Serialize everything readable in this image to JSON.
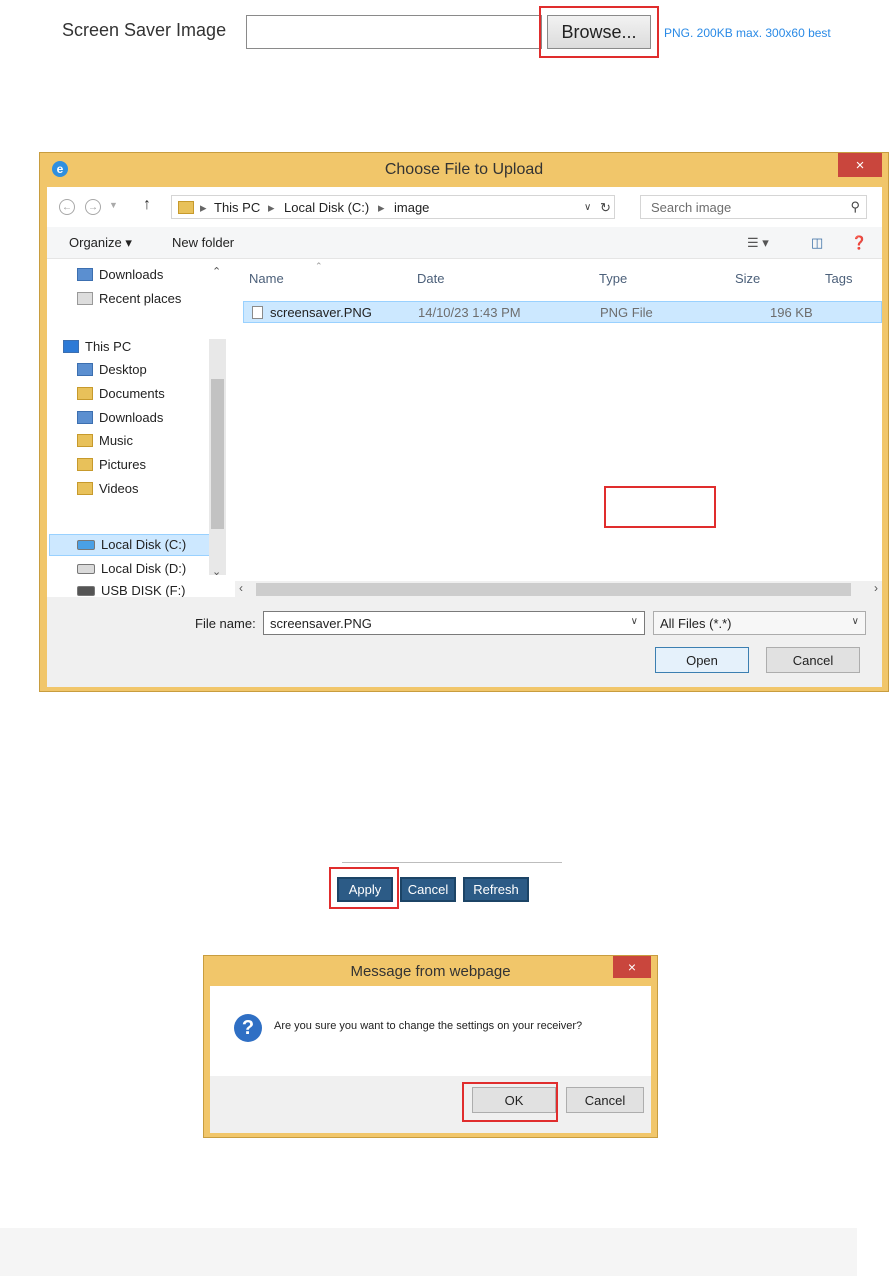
{
  "upload": {
    "label": "Screen Saver Image",
    "browse_label": "Browse...",
    "hint": "PNG. 200KB max. 300x60 best"
  },
  "file_dialog": {
    "title": "Choose File to Upload",
    "close": "×",
    "breadcrumb": [
      "This PC",
      "Local Disk (C:)",
      "image"
    ],
    "search_placeholder": "Search image",
    "commands": {
      "organize": "Organize ▾",
      "new_folder": "New folder"
    },
    "nav_items": [
      {
        "label": "Downloads",
        "icon": "folder-blue"
      },
      {
        "label": "Recent places",
        "icon": "recent"
      },
      {
        "label": "This PC",
        "icon": "computer"
      },
      {
        "label": "Desktop",
        "icon": "folder-blue"
      },
      {
        "label": "Documents",
        "icon": "folder"
      },
      {
        "label": "Downloads",
        "icon": "folder-blue"
      },
      {
        "label": "Music",
        "icon": "folder"
      },
      {
        "label": "Pictures",
        "icon": "folder"
      },
      {
        "label": "Videos",
        "icon": "folder"
      },
      {
        "label": "Local Disk (C:)",
        "icon": "drive"
      },
      {
        "label": "Local Disk (D:)",
        "icon": "drive"
      },
      {
        "label": "USB DISK (F:)",
        "icon": "drive"
      }
    ],
    "columns": {
      "name": "Name",
      "date": "Date",
      "type": "Type",
      "size": "Size",
      "tags": "Tags"
    },
    "files": [
      {
        "name": "screensaver.PNG",
        "date": "14/10/23 1:43 PM",
        "type": "PNG File",
        "size": "196 KB"
      }
    ],
    "file_name_label": "File name:",
    "file_name_value": "screensaver.PNG",
    "filter_value": "All Files (*.*)",
    "open_label": "Open",
    "cancel_label": "Cancel"
  },
  "action_bar": {
    "apply": "Apply",
    "cancel": "Cancel",
    "refresh": "Refresh"
  },
  "message_box": {
    "title": "Message from webpage",
    "close": "×",
    "text": "Are you sure you want to change the settings on your receiver?",
    "ok": "OK",
    "cancel": "Cancel"
  },
  "colors": {
    "highlight": "#e02d2d",
    "dialog_frame": "#f1c66a",
    "hint": "#2a8ae6",
    "web_button": "#2c5b86"
  }
}
